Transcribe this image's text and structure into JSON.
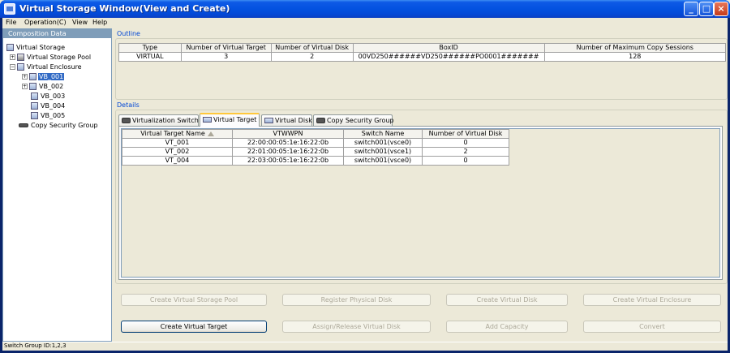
{
  "window": {
    "title": "Virtual Storage Window(View and Create)",
    "minimize_label": "_",
    "maximize_label": "□",
    "close_label": "×"
  },
  "menu": {
    "items": [
      "File",
      "Operation(C)",
      "View",
      "Help"
    ]
  },
  "composition": {
    "header": "Composition Data",
    "tree": {
      "root": "Virtual Storage",
      "pool": "Virtual Storage Pool",
      "enclosure": "Virtual Enclosure",
      "blocks": [
        "VB_001",
        "VB_002",
        "VB_003",
        "VB_004",
        "VB_005"
      ],
      "copy_group": "Copy Security Group",
      "expand_symbol": "+",
      "collapse_symbol": "−"
    }
  },
  "outline": {
    "label": "Outline",
    "headers": [
      "Type",
      "Number of Virtual Target",
      "Number of Virtual Disk",
      "BoxID",
      "Number of Maximum Copy Sessions"
    ],
    "rows": [
      [
        "VIRTUAL",
        "3",
        "2",
        "00VD250######VD250######PO0001#######",
        "128"
      ]
    ]
  },
  "details": {
    "label": "Details",
    "tabs": [
      "Virtualization Switch",
      "Virtual Target",
      "Virtual Disk",
      "Copy Security Group"
    ],
    "active_tab": "Virtual Target",
    "headers": [
      "Virtual Target Name",
      "VTWWPN",
      "Switch Name",
      "Number of Virtual Disk"
    ],
    "rows": [
      [
        "VT_001",
        "22:00:00:05:1e:16:22:0b",
        "switch001(vsce0)",
        "0"
      ],
      [
        "VT_002",
        "22:01:00:05:1e:16:22:0b",
        "switch001(vsce1)",
        "2"
      ],
      [
        "VT_004",
        "22:03:00:05:1e:16:22:0b",
        "switch001(vsce0)",
        "0"
      ]
    ]
  },
  "buttons": {
    "row1": [
      "Create Virtual Storage Pool",
      "Register Physical Disk",
      "Create Virtual Disk",
      "Create Virtual Enclosure"
    ],
    "row2": [
      "Create Virtual Target",
      "Assign/Release Virtual Disk",
      "Add Capacity",
      "Convert"
    ]
  },
  "status": {
    "text": "Switch Group ID:1,2,3"
  },
  "colors": {
    "titlebar": "#0352e0",
    "selection": "#316ac5",
    "group_label": "#0046d5",
    "active_tab_accent": "#ffc83c"
  }
}
